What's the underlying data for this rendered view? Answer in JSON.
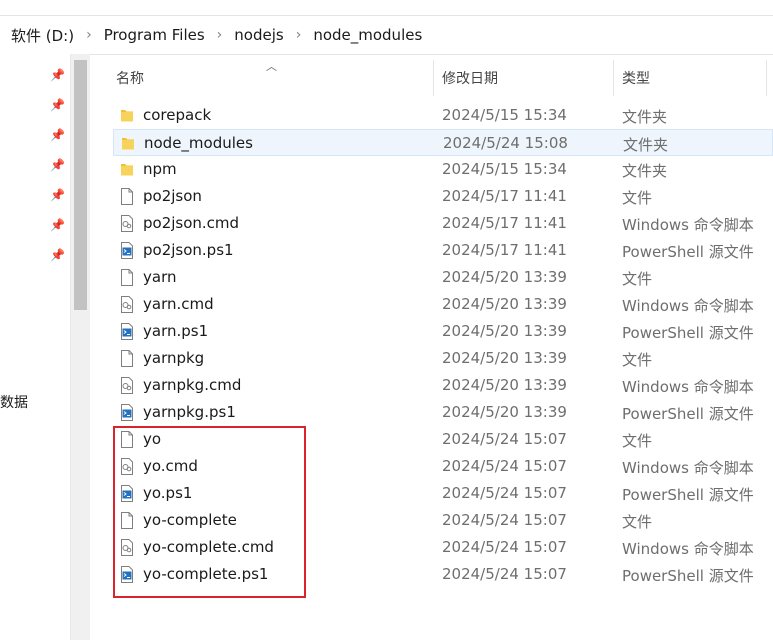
{
  "breadcrumb": [
    "软件 (D:)",
    "Program Files",
    "nodejs",
    "node_modules"
  ],
  "nav": {
    "partial_text": "数据"
  },
  "columns": {
    "name": "名称",
    "date": "修改日期",
    "type": "类型"
  },
  "files": [
    {
      "name": "corepack",
      "date": "2024/5/15 15:34",
      "type": "文件夹",
      "icon": "folder-icon"
    },
    {
      "name": "node_modules",
      "date": "2024/5/24 15:08",
      "type": "文件夹",
      "icon": "folder-icon"
    },
    {
      "name": "npm",
      "date": "2024/5/15 15:34",
      "type": "文件夹",
      "icon": "folder-icon"
    },
    {
      "name": "po2json",
      "date": "2024/5/17 11:41",
      "type": "文件",
      "icon": "file-icon"
    },
    {
      "name": "po2json.cmd",
      "date": "2024/5/17 11:41",
      "type": "Windows 命令脚本",
      "icon": "cmd-file-icon"
    },
    {
      "name": "po2json.ps1",
      "date": "2024/5/17 11:41",
      "type": "PowerShell 源文件",
      "icon": "powershell-file-icon"
    },
    {
      "name": "yarn",
      "date": "2024/5/20 13:39",
      "type": "文件",
      "icon": "file-icon"
    },
    {
      "name": "yarn.cmd",
      "date": "2024/5/20 13:39",
      "type": "Windows 命令脚本",
      "icon": "cmd-file-icon"
    },
    {
      "name": "yarn.ps1",
      "date": "2024/5/20 13:39",
      "type": "PowerShell 源文件",
      "icon": "powershell-file-icon"
    },
    {
      "name": "yarnpkg",
      "date": "2024/5/20 13:39",
      "type": "文件",
      "icon": "file-icon"
    },
    {
      "name": "yarnpkg.cmd",
      "date": "2024/5/20 13:39",
      "type": "Windows 命令脚本",
      "icon": "cmd-file-icon"
    },
    {
      "name": "yarnpkg.ps1",
      "date": "2024/5/20 13:39",
      "type": "PowerShell 源文件",
      "icon": "powershell-file-icon"
    },
    {
      "name": "yo",
      "date": "2024/5/24 15:07",
      "type": "文件",
      "icon": "file-icon"
    },
    {
      "name": "yo.cmd",
      "date": "2024/5/24 15:07",
      "type": "Windows 命令脚本",
      "icon": "cmd-file-icon"
    },
    {
      "name": "yo.ps1",
      "date": "2024/5/24 15:07",
      "type": "PowerShell 源文件",
      "icon": "powershell-file-icon"
    },
    {
      "name": "yo-complete",
      "date": "2024/5/24 15:07",
      "type": "文件",
      "icon": "file-icon"
    },
    {
      "name": "yo-complete.cmd",
      "date": "2024/5/24 15:07",
      "type": "Windows 命令脚本",
      "icon": "cmd-file-icon"
    },
    {
      "name": "yo-complete.ps1",
      "date": "2024/5/24 15:07",
      "type": "PowerShell 源文件",
      "icon": "powershell-file-icon"
    }
  ],
  "colors": {
    "highlight": "#d9232d",
    "folder": "#f2c12e",
    "selection": "#eef5fc"
  }
}
